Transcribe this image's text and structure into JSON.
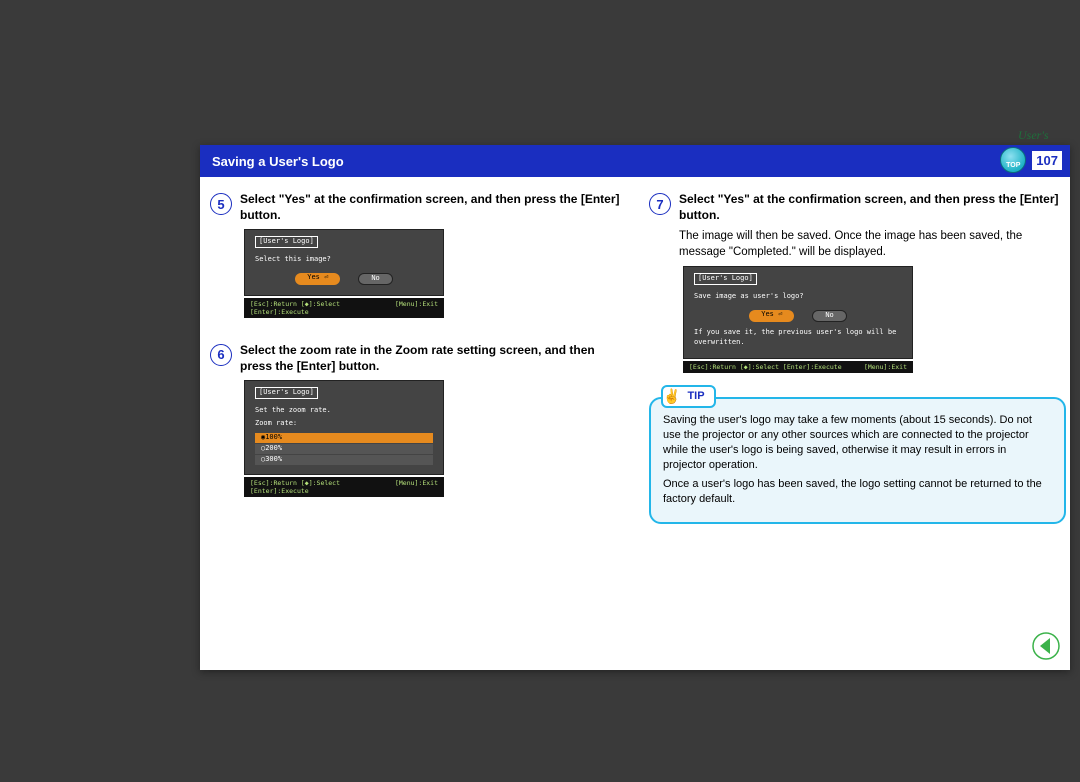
{
  "guide_label": "User's Guide",
  "header": {
    "title": "Saving a User's Logo",
    "badge_text": "TOP",
    "page_number": "107"
  },
  "steps": {
    "5": {
      "num": "5",
      "title": "Select \"Yes\" at the confirmation screen, and then press the [Enter] button.",
      "osd": {
        "label": "[User's Logo]",
        "line1": "Select this image?",
        "yes": "Yes ⏎",
        "no": "No",
        "foot_left": "[Esc]:Return [◆]:Select [Enter]:Execute",
        "foot_right": "[Menu]:Exit"
      }
    },
    "6": {
      "num": "6",
      "title": "Select the zoom rate in the Zoom rate setting screen, and then press the [Enter] button.",
      "osd": {
        "label": "[User's Logo]",
        "line1": "Set the zoom rate.",
        "line2": "Zoom rate:",
        "opts": [
          "◉100%",
          "○200%",
          "○300%"
        ],
        "foot_left": "[Esc]:Return [◆]:Select [Enter]:Execute",
        "foot_right": "[Menu]:Exit"
      }
    },
    "7": {
      "num": "7",
      "title": "Select \"Yes\" at the confirmation screen, and then press the [Enter] button.",
      "desc": "The image will then be saved. Once the image has been saved, the message \"Completed.\" will be displayed.",
      "osd": {
        "label": "[User's Logo]",
        "line1": "Save image as user's logo?",
        "yes": "Yes ⏎",
        "no": "No",
        "note": "If you save it, the previous user's logo will be overwritten.",
        "foot_left": "[Esc]:Return [◆]:Select [Enter]:Execute",
        "foot_right": "[Menu]:Exit"
      }
    }
  },
  "tip": {
    "label": "TIP",
    "p1": "Saving the user's logo may take a few moments (about 15 seconds). Do not use the projector or any other sources which are connected to the projector while the user's logo is being saved, otherwise it may result in errors in projector operation.",
    "p2": "Once a user's logo has been saved, the logo setting cannot be returned to the factory default."
  }
}
